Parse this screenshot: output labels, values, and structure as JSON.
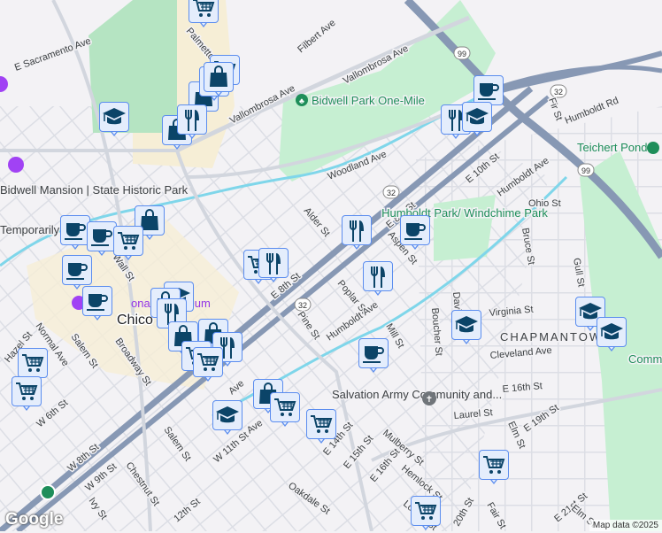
{
  "map": {
    "streets": [
      "E Sacramento Ave",
      "Palmetto Ave",
      "Filbert Ave",
      "Vallombrosa Ave",
      "Vallombrosa Ave",
      "Woodland Ave",
      "Humboldt Rd",
      "E 10th St",
      "Humboldt Ave",
      "Ohio St",
      "Bruce St",
      "Gull St",
      "Alder St",
      "E 8th St",
      "Aspen St",
      "Poplar St",
      "Humboldt Ave",
      "Mill St",
      "Pine St",
      "E 8th St",
      "Davis St",
      "Boucher St",
      "Virginia St",
      "Cleveland Ave",
      "E 16th St",
      "Laurel St",
      "E 19th St",
      "Elm St",
      "Fir St",
      "Wall St",
      "Normal Ave",
      "Salem St",
      "Broadway St",
      "W 6th St",
      "W 8th St",
      "W 9th St",
      "W 11th St",
      "Chestnut St",
      "Salem St",
      "Ivy St",
      "12th St",
      "Oakdale St",
      "E 14th St",
      "E 15th St",
      "E 16th St",
      "Mulberry St",
      "Hemlock St",
      "Locust St",
      "20th St",
      "Fair St",
      "E 21st St",
      "Elm St",
      "Ave",
      "Ave",
      "Hazel St"
    ],
    "highways": [
      "99",
      "32",
      "32",
      "32",
      "99"
    ],
    "parks": [
      "Bidwell Park One-Mile",
      "Teichert Ponds",
      "Humboldt Park/ Windchime Park",
      "Comm Pa"
    ],
    "pois": [
      "Bidwell Mansion | State Historic Park",
      "Temporarily closed",
      "Salvation Army Community and...",
      "onal Y Museum"
    ],
    "neighborhood": "CHAPMANTOWN",
    "city": "Chico",
    "markers": [
      "cart",
      "cart",
      "bag",
      "cart",
      "bag",
      "grad",
      "bag",
      "fork",
      "coffee",
      "fork",
      "grad",
      "fork",
      "coffee",
      "fork",
      "bag",
      "coffee",
      "coffee",
      "cart",
      "coffee",
      "coffee",
      "cart",
      "fork",
      "grad",
      "bag",
      "fork",
      "bag",
      "bag",
      "fork",
      "cart",
      "cart",
      "grad",
      "grad",
      "grad",
      "coffee",
      "cart",
      "cart",
      "bag",
      "cart",
      "grad",
      "cart",
      "cart",
      "cart"
    ],
    "attribution": "Map data ©2025",
    "logo": "Google"
  }
}
